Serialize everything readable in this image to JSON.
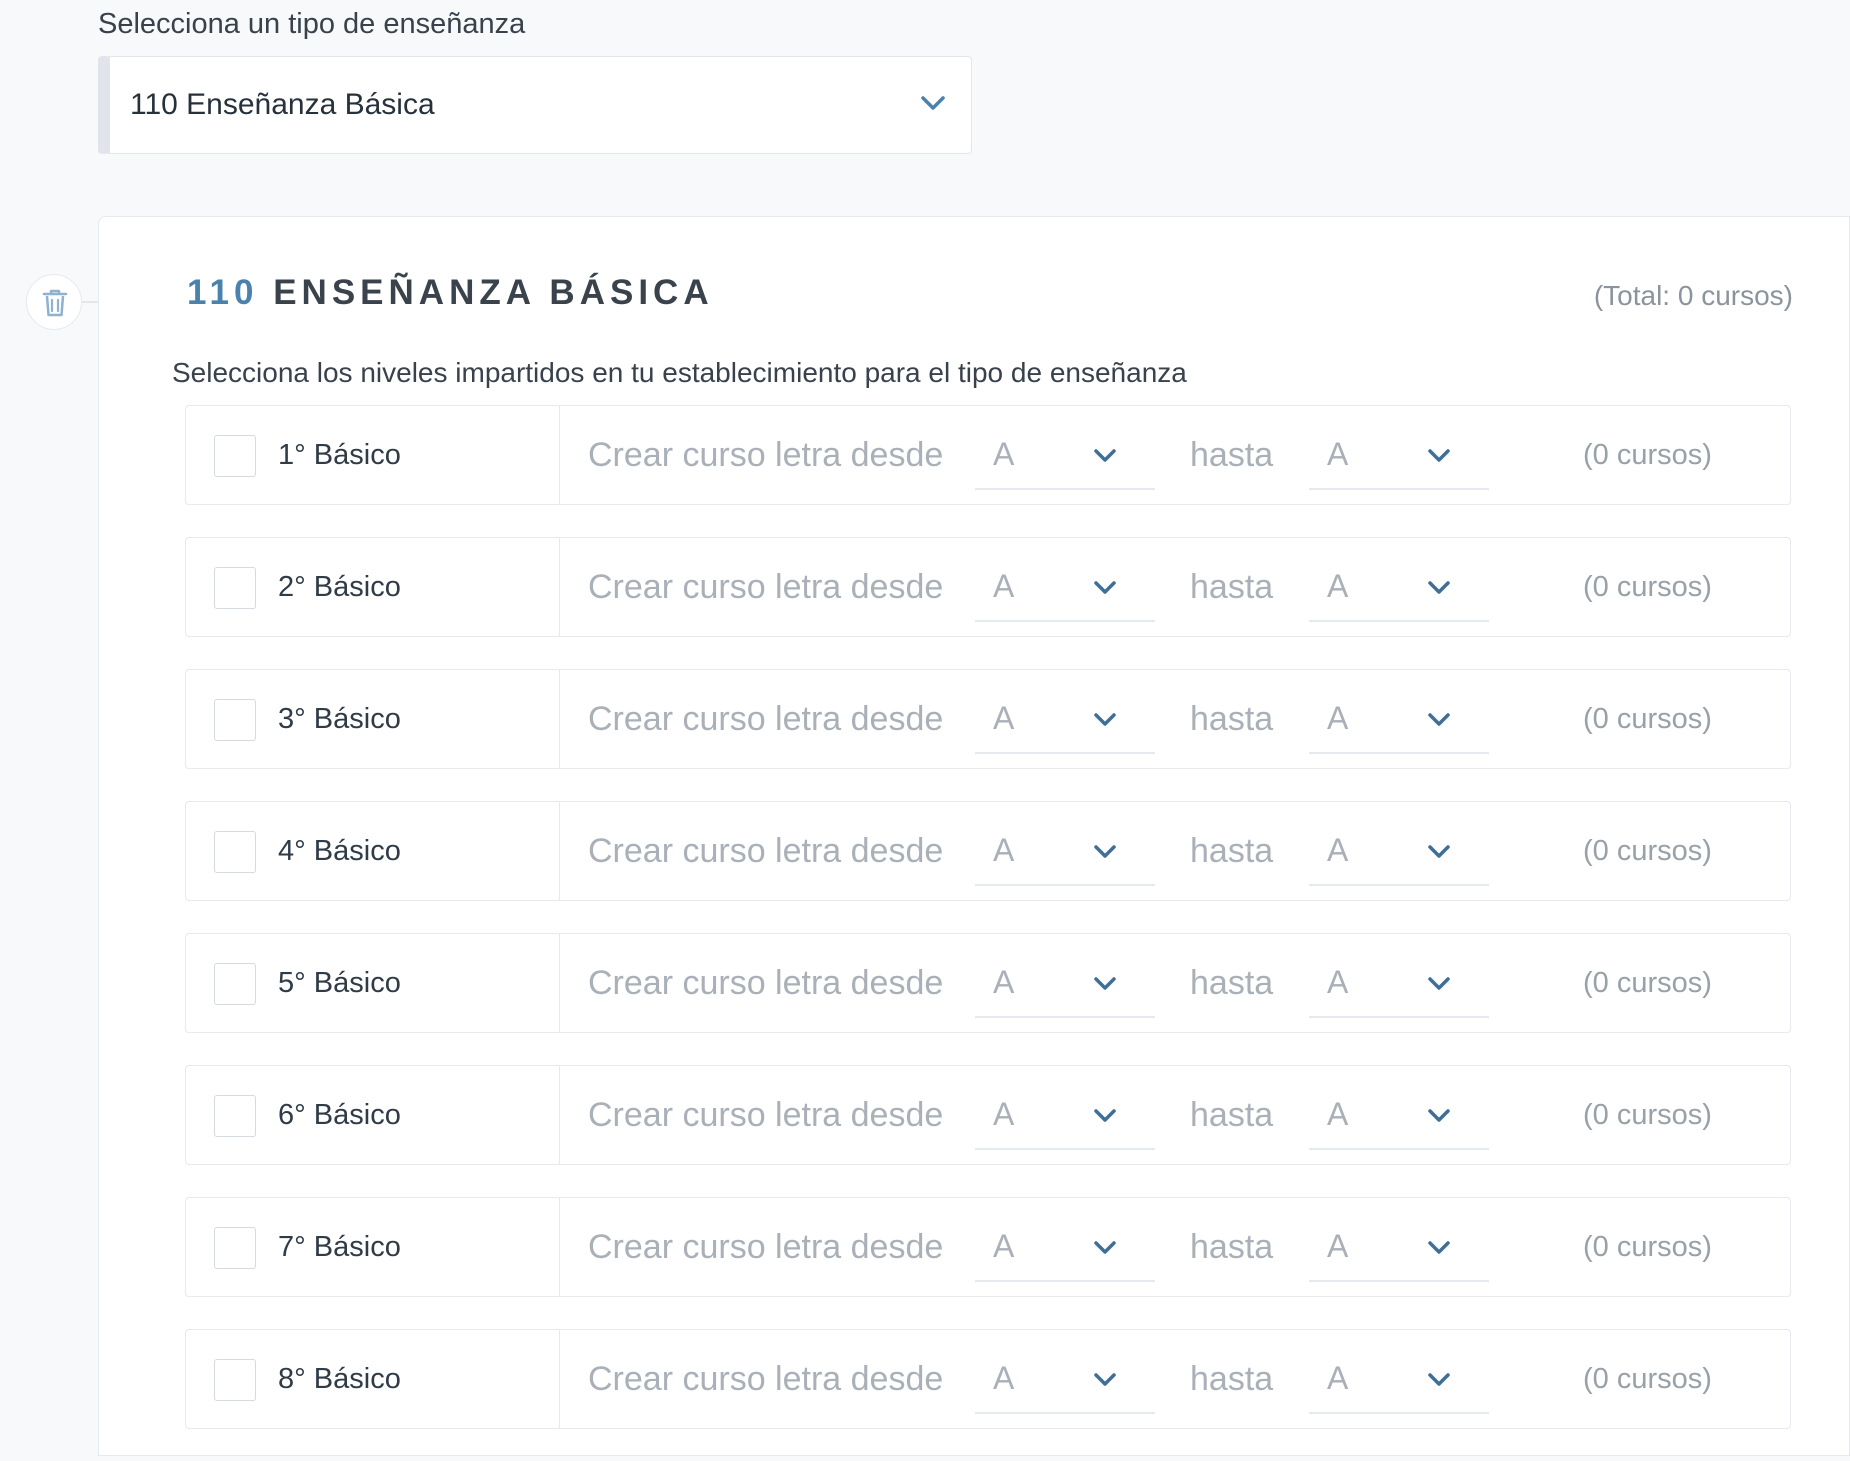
{
  "selector": {
    "label": "Selecciona un tipo de enseñanza",
    "value": "110 Enseñanza Básica"
  },
  "panel": {
    "code": "110",
    "name": "ENSEÑANZA BÁSICA",
    "total": "(Total: 0 cursos)",
    "description": "Selecciona los niveles impartidos en tu establecimiento para el tipo de enseñanza"
  },
  "row_labels": {
    "create": "Crear curso letra desde",
    "until": "hasta"
  },
  "levels": [
    {
      "name": "1° Básico",
      "from": "A",
      "to": "A",
      "count": "(0 cursos)"
    },
    {
      "name": "2° Básico",
      "from": "A",
      "to": "A",
      "count": "(0 cursos)"
    },
    {
      "name": "3° Básico",
      "from": "A",
      "to": "A",
      "count": "(0 cursos)"
    },
    {
      "name": "4° Básico",
      "from": "A",
      "to": "A",
      "count": "(0 cursos)"
    },
    {
      "name": "5° Básico",
      "from": "A",
      "to": "A",
      "count": "(0 cursos)"
    },
    {
      "name": "6° Básico",
      "from": "A",
      "to": "A",
      "count": "(0 cursos)"
    },
    {
      "name": "7° Básico",
      "from": "A",
      "to": "A",
      "count": "(0 cursos)"
    },
    {
      "name": "8° Básico",
      "from": "A",
      "to": "A",
      "count": "(0 cursos)"
    }
  ],
  "icons": {
    "delete": "trash-icon",
    "dropdown": "chevron-down-icon"
  },
  "colors": {
    "accent": "#4a82ad",
    "muted_text": "#a9b0b8",
    "border": "#e6e9ee"
  }
}
